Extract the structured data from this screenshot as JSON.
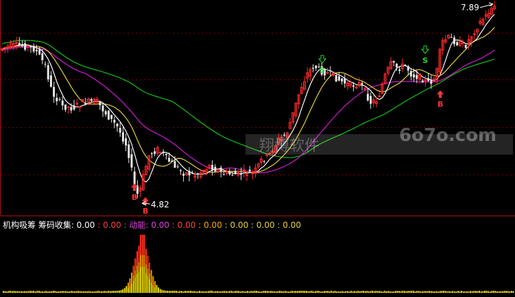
{
  "chart_data": {
    "type": "candlestick",
    "price_labels": {
      "high": "7.89",
      "low": "4.82"
    },
    "moving_average_colors": {
      "white": "#ffffff",
      "yellow": "#e8d23a",
      "magenta": "#d21ad2",
      "green": "#16c016"
    },
    "candle_colors": {
      "up": "#ff2a2a",
      "down": "#e8e8e8"
    },
    "signals": [
      {
        "type": "buy",
        "label": "B",
        "color": "#ff3333"
      },
      {
        "type": "buy",
        "label": "B",
        "color": "#ff3333"
      },
      {
        "type": "sell",
        "label": "S",
        "color": "#22dd22"
      },
      {
        "type": "sell",
        "label": "S",
        "color": "#22dd22"
      },
      {
        "type": "buy",
        "label": "B",
        "color": "#ff3333"
      }
    ],
    "indicator_panel": {
      "title": "机构吸筹",
      "items": [
        {
          "label": "筹码收集",
          "value": "0.00",
          "color": "#ffffff"
        },
        {
          "label": "",
          "value": "0.00",
          "color": "#ff4040"
        },
        {
          "label": "动能",
          "value": "0.00",
          "color": "#e040e0"
        },
        {
          "label": "",
          "value": "0.00",
          "color": "#ff4040"
        },
        {
          "label": "",
          "value": "0.00",
          "color": "#ffaa00"
        },
        {
          "label": "",
          "value": "0.00",
          "color": "#e8d23a"
        },
        {
          "label": "",
          "value": "0.00",
          "color": "#e8d23a"
        },
        {
          "label": "",
          "value": "0.00",
          "color": "#e8d23a"
        }
      ],
      "histogram_colors": [
        "#ffee00",
        "#ff8c00",
        "#ff2020"
      ]
    },
    "watermarks": {
      "site": "6o7o.com",
      "brand": "翔博软件"
    }
  }
}
